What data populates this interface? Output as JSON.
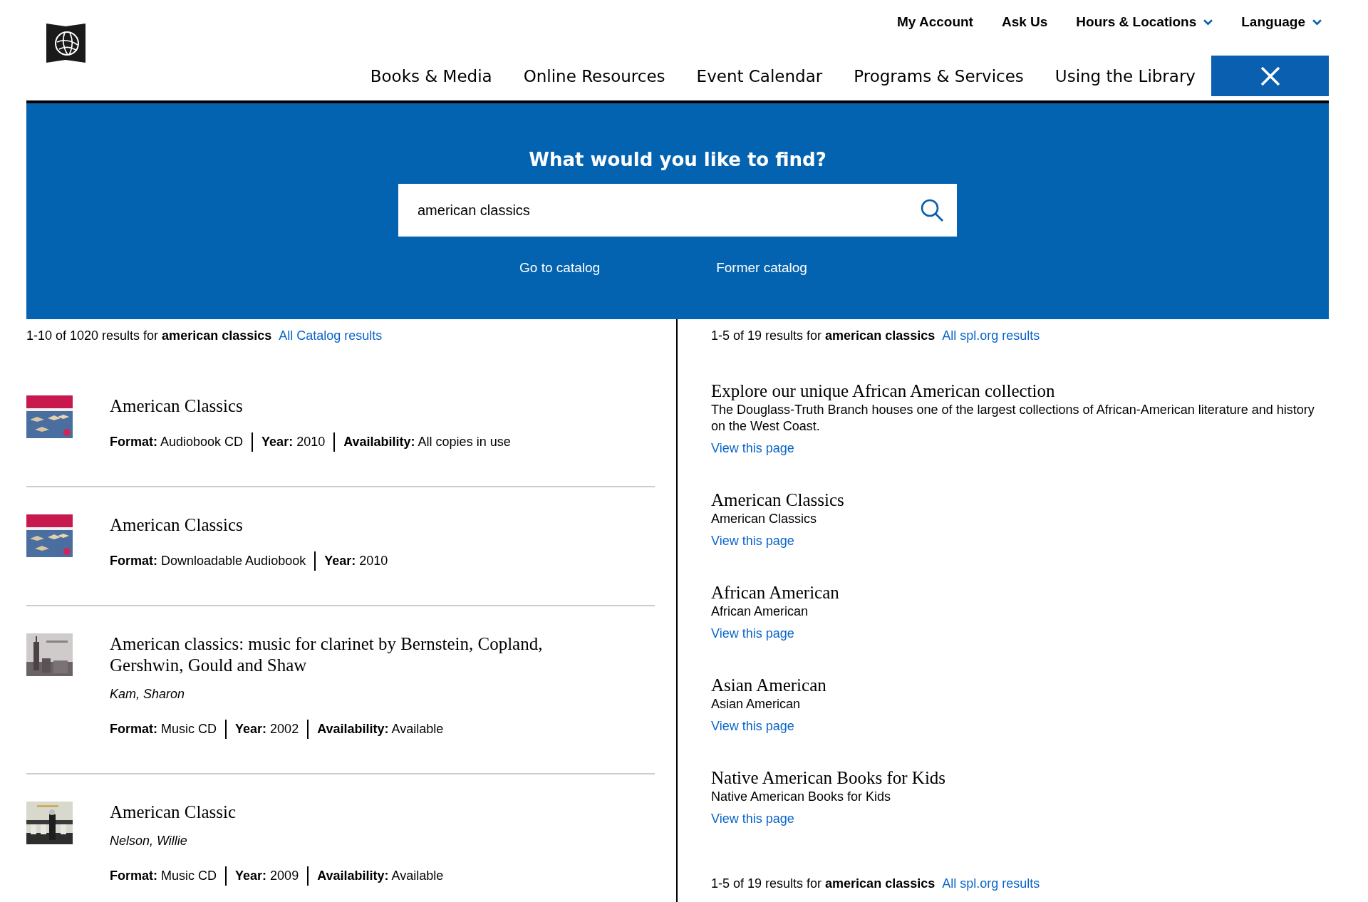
{
  "header": {
    "utility_links": [
      {
        "label": "My Account",
        "dropdown": false
      },
      {
        "label": "Ask Us",
        "dropdown": false
      },
      {
        "label": "Hours & Locations",
        "dropdown": true
      },
      {
        "label": "Language",
        "dropdown": true
      }
    ],
    "nav": [
      "Books & Media",
      "Online Resources",
      "Event Calendar",
      "Programs & Services",
      "Using the Library"
    ]
  },
  "search": {
    "heading": "What would you like to find?",
    "value": "american classics",
    "links": [
      "Go to catalog",
      "Former catalog"
    ]
  },
  "catalog": {
    "summary": "1-10 of 1020 results for **american classics**",
    "all_link": "All Catalog results",
    "results": [
      {
        "title": "American Classics",
        "fields": [
          {
            "label": "Format:",
            "value": "Audiobook CD"
          },
          {
            "label": "Year:",
            "value": "2010"
          },
          {
            "label": "Availability:",
            "value": "All copies in use"
          }
        ]
      },
      {
        "title": "American Classics",
        "fields": [
          {
            "label": "Format:",
            "value": "Downloadable Audiobook"
          },
          {
            "label": "Year:",
            "value": "2010"
          }
        ]
      },
      {
        "title": "American classics: music for clarinet by Bernstein, Copland, Gershwin, Gould and Shaw",
        "author": "Kam, Sharon",
        "fields": [
          {
            "label": "Format:",
            "value": "Music CD"
          },
          {
            "label": "Year:",
            "value": "2002"
          },
          {
            "label": "Availability:",
            "value": "Available"
          }
        ]
      },
      {
        "title": "American Classic",
        "author": "Nelson, Willie",
        "fields": [
          {
            "label": "Format:",
            "value": "Music CD"
          },
          {
            "label": "Year:",
            "value": "2009"
          },
          {
            "label": "Availability:",
            "value": "Available"
          }
        ]
      }
    ]
  },
  "site": {
    "summary": "1-5 of 19 results for **american classics**",
    "all_link": "All spl.org results",
    "results": [
      {
        "title": "Explore our unique African American collection",
        "description": "The Douglass-Truth Branch houses one of the largest collections of African-American literature and history on the West Coast.",
        "link": "View this page"
      },
      {
        "title": "American Classics",
        "description": "American Classics",
        "link": "View this page"
      },
      {
        "title": "African American",
        "description": "African American",
        "link": "View this page"
      },
      {
        "title": "Asian American",
        "description": "Asian American",
        "link": "View this page"
      },
      {
        "title": "Native American Books for Kids",
        "description": "Native American Books for Kids",
        "link": "View this page"
      }
    ],
    "footer_summary": "1-5 of 19 results for **american classics**",
    "footer_link": "All spl.org results"
  }
}
